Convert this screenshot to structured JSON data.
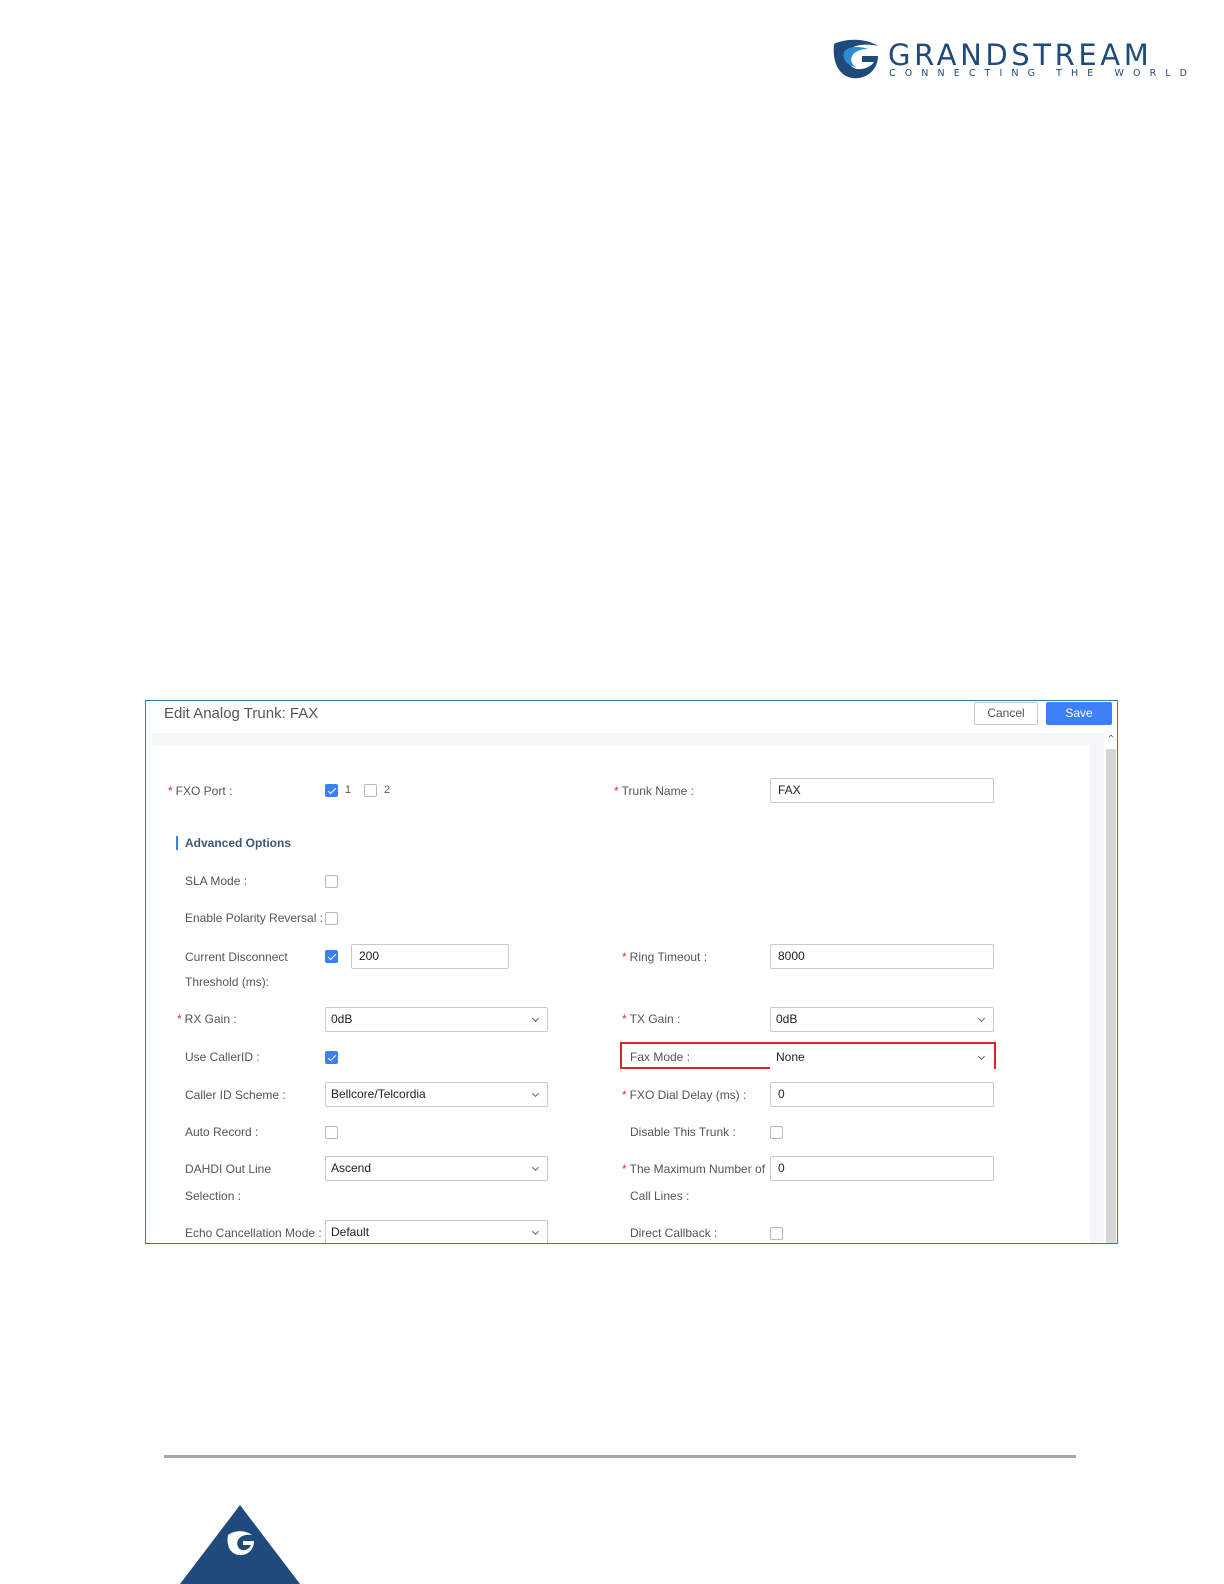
{
  "brand": {
    "name": "GRANDSTREAM",
    "tagline": "CONNECTING THE WORLD"
  },
  "dialog": {
    "title": "Edit Analog Trunk: FAX",
    "cancel_label": "Cancel",
    "save_label": "Save",
    "fields": {
      "fxo_port": {
        "label": "FXO Port :",
        "options": [
          "1",
          "2"
        ],
        "checked": [
          true,
          false
        ]
      },
      "trunk_name": {
        "label": "Trunk Name :",
        "value": "FAX"
      },
      "advanced_options": "Advanced Options",
      "sla_mode": {
        "label": "SLA Mode :",
        "checked": false
      },
      "enable_polarity_reversal": {
        "label": "Enable Polarity Reversal :",
        "checked": false
      },
      "current_disconnect": {
        "label_line1": "Current Disconnect",
        "label_line2": "Threshold (ms):",
        "checked": true,
        "value": "200"
      },
      "ring_timeout": {
        "label": "Ring Timeout :",
        "value": "8000"
      },
      "rx_gain": {
        "label": "RX Gain :",
        "value": "0dB"
      },
      "tx_gain": {
        "label": "TX Gain :",
        "value": "0dB"
      },
      "use_caller_id": {
        "label": "Use CallerID :",
        "checked": true
      },
      "fax_mode": {
        "label": "Fax Mode :",
        "value": "None"
      },
      "caller_id_scheme": {
        "label": "Caller ID Scheme :",
        "value": "Bellcore/Telcordia"
      },
      "fxo_dial_delay": {
        "label": "FXO Dial Delay (ms) :",
        "value": "0"
      },
      "auto_record": {
        "label": "Auto Record :",
        "checked": false
      },
      "disable_this_trunk": {
        "label": "Disable This Trunk :",
        "checked": false
      },
      "dahdi_out_line": {
        "label_line1": "DAHDI Out Line",
        "label_line2": "Selection :",
        "value": "Ascend"
      },
      "max_call_lines": {
        "label_line1": "The Maximum Number of",
        "label_line2": "Call Lines :",
        "value": "0"
      },
      "echo_cancellation_mode": {
        "label": "Echo Cancellation Mode :",
        "value": "Default"
      },
      "direct_callback": {
        "label": "Direct Callback :",
        "checked": false
      }
    }
  },
  "colors": {
    "brand_blue": "#1f4a7c",
    "accent_blue": "#3d7ff4",
    "highlight_red": "#d9262a",
    "required_red": "#e0342b"
  },
  "icons": [
    "grandstream-logo-icon",
    "chevron-down-icon",
    "scroll-up-icon",
    "checkbox-checked-icon"
  ]
}
